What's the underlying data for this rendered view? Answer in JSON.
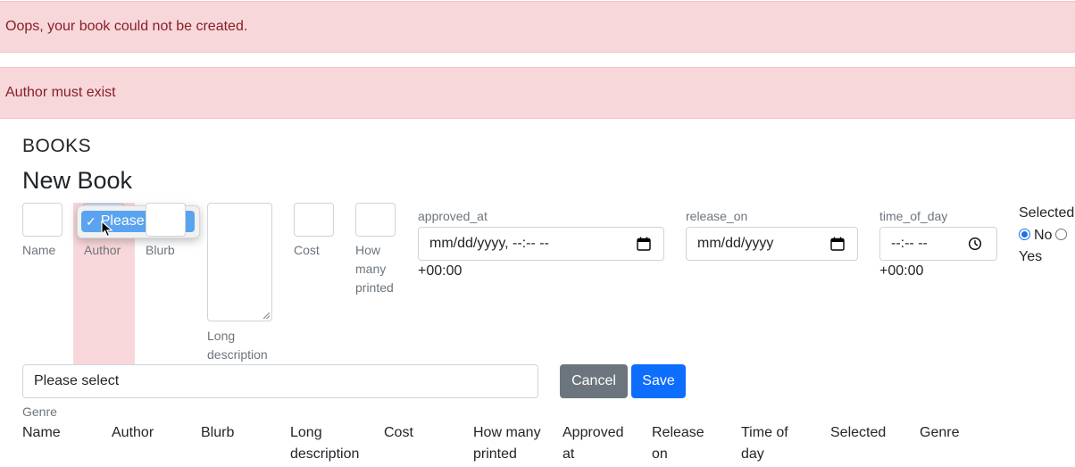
{
  "alerts": {
    "error": "Oops, your book could not be created.",
    "detail": "Author must exist"
  },
  "section_title": "BOOKS",
  "page_title": "New Book",
  "fields": {
    "name_label": "Name",
    "author_label": "Author",
    "author_option": "Please select",
    "blurb_label": "Blurb",
    "long_description_label": "Long description",
    "cost_label": "Cost",
    "how_many_printed_label": "How many printed",
    "approved_at_label": "approved_at",
    "approved_at_value": "mm/dd/yyyy, --:-- --",
    "approved_at_tz": "+00:00",
    "release_on_label": "release_on",
    "release_on_value": "mm/dd/yyyy",
    "time_of_day_label": "time_of_day",
    "time_of_day_value": "--:-- --",
    "time_of_day_tz": "+00:00",
    "selected_label": "Selected",
    "selected_options": [
      "No",
      "Yes"
    ],
    "selected_value": "No",
    "genre_value": "Please select",
    "genre_label": "Genre"
  },
  "buttons": {
    "cancel": "Cancel",
    "save": "Save"
  },
  "table": {
    "headers": [
      "Name",
      "Author",
      "Blurb",
      "Long description",
      "Cost",
      "How many printed",
      "Approved at",
      "Release on",
      "Time of day",
      "Selected",
      "Genre"
    ]
  },
  "colors": {
    "alert_bg": "#f8d7da",
    "alert_text": "#842029",
    "primary": "#0d6efd",
    "secondary": "#6c757d",
    "option_highlight": "#5aa3ee"
  }
}
